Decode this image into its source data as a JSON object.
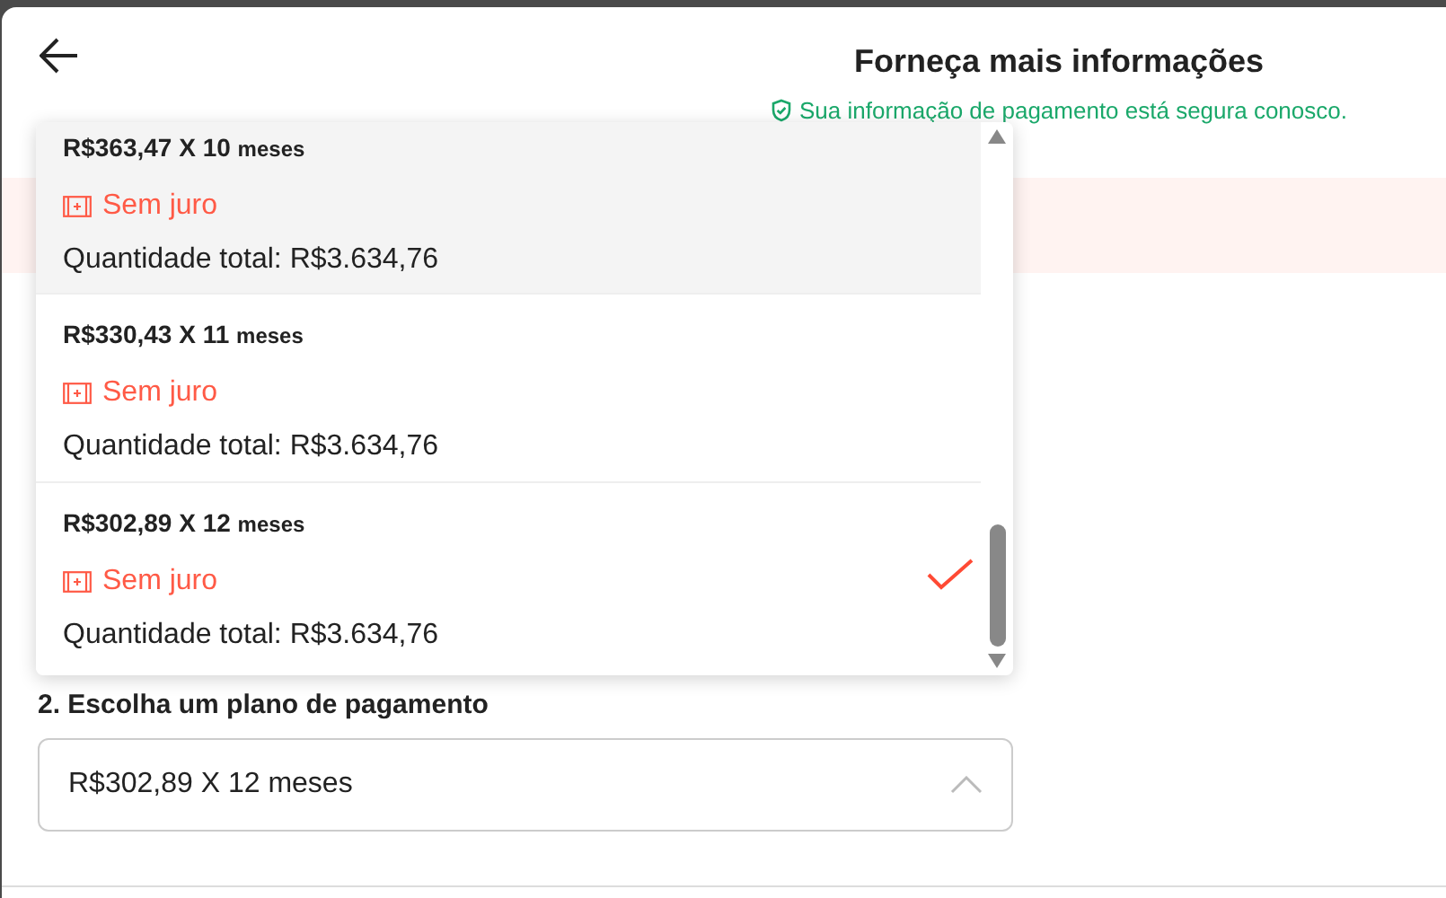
{
  "header": {
    "title": "Forneça mais informações",
    "secure_note": "Sua informação de pagamento está segura conosco."
  },
  "step_label": "2. Escolha um plano de pagamento",
  "select": {
    "value": "R$302,89 X 12 meses",
    "expanded": true
  },
  "options": [
    {
      "amount": "R$363,47 X 10",
      "unit": "meses",
      "interest": "Sem juro",
      "total": "Quantidade total: R$3.634,76",
      "highlighted": true,
      "selected": false
    },
    {
      "amount": "R$330,43 X 11",
      "unit": "meses",
      "interest": "Sem juro",
      "total": "Quantidade total: R$3.634,76",
      "highlighted": false,
      "selected": false
    },
    {
      "amount": "R$302,89 X 12",
      "unit": "meses",
      "interest": "Sem juro",
      "total": "Quantidade total: R$3.634,76",
      "highlighted": false,
      "selected": true
    }
  ]
}
